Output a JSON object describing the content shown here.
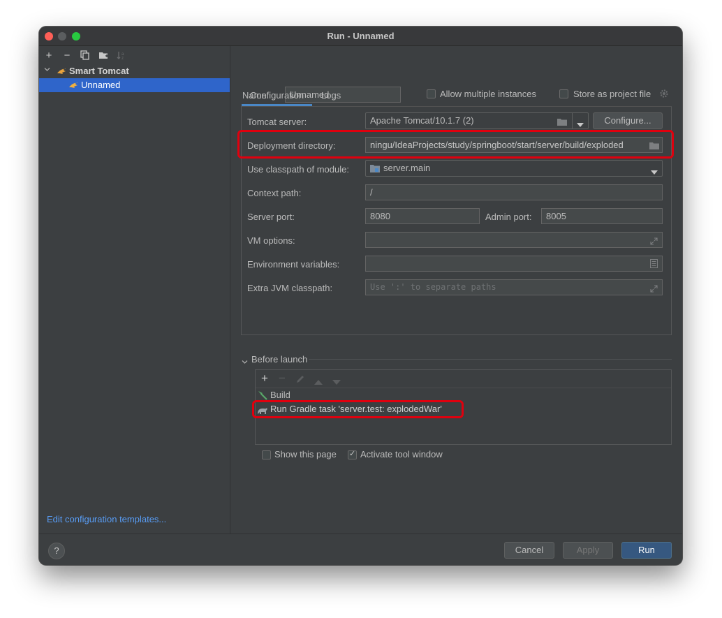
{
  "window": {
    "title": "Run - Unnamed"
  },
  "sidebar": {
    "toolbar": [
      "add-icon",
      "remove-icon",
      "copy-icon",
      "new-folder-icon",
      "sort-icon"
    ],
    "tree": {
      "parent_label": "Smart Tomcat",
      "child_label": "Unnamed"
    },
    "templates_link": "Edit configuration templates..."
  },
  "header": {
    "name_label": "Name:",
    "name_value": "Unnamed",
    "allow_multiple_label": "Allow multiple instances",
    "store_as_file_label": "Store as project file"
  },
  "tabs": [
    "Configuration",
    "Logs"
  ],
  "config": {
    "tomcat_server_label": "Tomcat server:",
    "tomcat_server_value": "Apache Tomcat/10.1.7 (2)",
    "configure_button": "Configure...",
    "deployment_dir_label": "Deployment directory:",
    "deployment_dir_value": "ningu/IdeaProjects/study/springboot/start/server/build/exploded",
    "classpath_module_label": "Use classpath of module:",
    "classpath_module_value": "server.main",
    "context_path_label": "Context path:",
    "context_path_value": "/",
    "server_port_label": "Server port:",
    "server_port_value": "8080",
    "admin_port_label": "Admin port:",
    "admin_port_value": "8005",
    "vm_options_label": "VM options:",
    "vm_options_value": "",
    "env_vars_label": "Environment variables:",
    "env_vars_value": "",
    "extra_classpath_label": "Extra JVM classpath:",
    "extra_classpath_placeholder": "Use ':' to separate paths"
  },
  "before_launch": {
    "title": "Before launch",
    "items": [
      "Build",
      "Run Gradle task 'server.test: explodedWar'"
    ],
    "show_page_label": "Show this page",
    "show_page_checked": false,
    "activate_tool_label": "Activate tool window",
    "activate_tool_checked": true
  },
  "footer": {
    "help": "?",
    "cancel": "Cancel",
    "apply": "Apply",
    "run": "Run"
  },
  "colors": {
    "background": "#3c3f41",
    "selection": "#2f65ca",
    "link": "#589df6",
    "highlight": "#e0000e",
    "run_button": "#365880"
  }
}
